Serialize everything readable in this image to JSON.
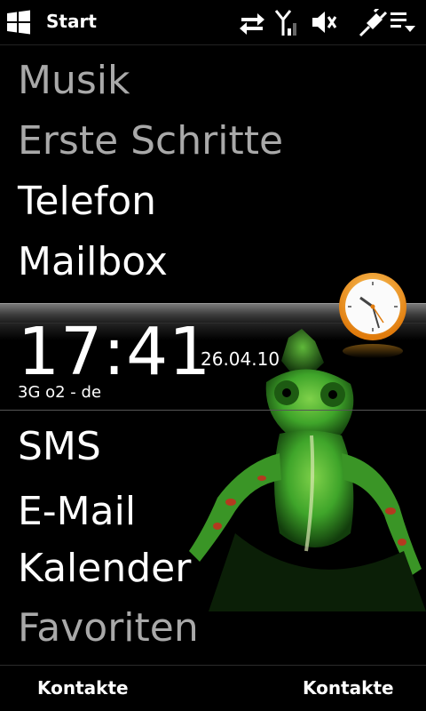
{
  "titlebar": {
    "title": "Start",
    "icons": [
      "windows-logo",
      "data-sync-icon",
      "signal-strength-icon",
      "speaker-muted-icon",
      "charging-plug-icon",
      "menu-dropdown-icon"
    ]
  },
  "menu_top": [
    {
      "label": "Musik",
      "style": "dim"
    },
    {
      "label": "Erste Schritte",
      "style": "dim"
    },
    {
      "label": "Telefon",
      "style": "bright"
    },
    {
      "label": "Mailbox",
      "style": "bright"
    }
  ],
  "clock": {
    "time": "17:41",
    "date": "26.04.10",
    "network": "3G o2 - de",
    "icon": "analog-clock-icon"
  },
  "menu_bottom": [
    {
      "label": "SMS",
      "style": "bright"
    },
    {
      "label": "E-Mail",
      "style": "bright"
    },
    {
      "label": "Kalender",
      "style": "bright"
    },
    {
      "label": "Favoriten",
      "style": "dim"
    }
  ],
  "softkeys": {
    "left": "Kontakte",
    "right": "Kontakte"
  },
  "colors": {
    "background": "#000000",
    "text_bright": "#ffffff",
    "text_dim": "#a9a9a9",
    "clock_face": "#f6a623",
    "chameleon_green": "#3fa52a"
  }
}
